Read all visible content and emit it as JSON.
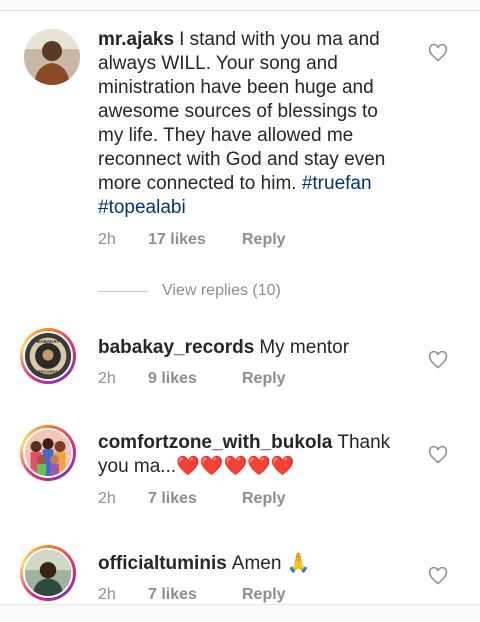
{
  "comments": [
    {
      "username": "mr.ajaks",
      "text": "I stand with you ma and always WILL. Your song and ministration have been huge and awesome sources of blessings to my life. They have allowed me reconnect with God and stay even more connected to him.",
      "hashtags": "#truefan #topealabi",
      "time": "2h",
      "likes": "17 likes",
      "reply": "Reply",
      "avatar_icon": "user-photo",
      "view_replies": "View replies (10)"
    },
    {
      "username": "babakay_records",
      "text": "My mentor",
      "time": "2h",
      "likes": "9 likes",
      "reply": "Reply",
      "avatar_icon": "babakay-records-logo",
      "avatar_logo_text": "BABAKAY RECORDS"
    },
    {
      "username": "comfortzone_with_bukola",
      "text": "Thank you ma...",
      "emoji": "❤️❤️❤️❤️❤️",
      "time": "2h",
      "likes": "7 likes",
      "reply": "Reply",
      "avatar_icon": "illustrated-group-avatar"
    },
    {
      "username": "officialtuminis",
      "text": "Amen",
      "emoji": "🙏",
      "time": "2h",
      "likes": "7 likes",
      "reply": "Reply",
      "avatar_icon": "user-photo"
    }
  ],
  "colors": {
    "username": "#262626",
    "meta": "#8e8e8e",
    "hashtag": "#00376b",
    "heart_emoji": "#e0241c"
  },
  "like_icon": "heart-outline-icon"
}
